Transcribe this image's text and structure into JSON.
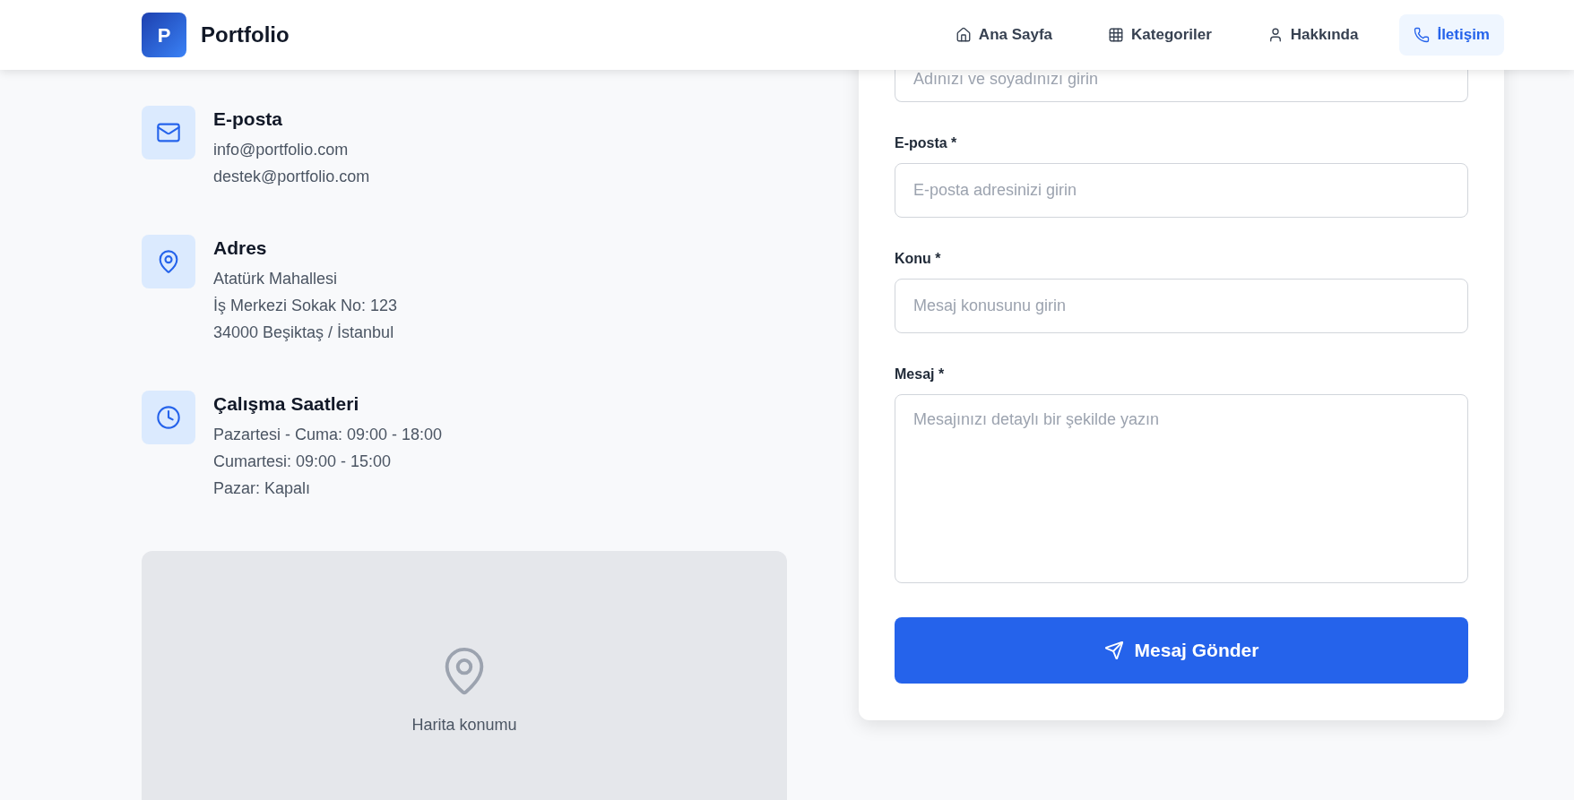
{
  "header": {
    "logo_letter": "P",
    "brand": "Portfolio",
    "nav": [
      {
        "label": "Ana Sayfa",
        "selected": false
      },
      {
        "label": "Kategoriler",
        "selected": false
      },
      {
        "label": "Hakkında",
        "selected": false
      },
      {
        "label": "İletişim",
        "selected": true
      }
    ]
  },
  "contact_info": [
    {
      "title": "E-posta",
      "lines": [
        "info@portfolio.com",
        "destek@portfolio.com"
      ]
    },
    {
      "title": "Adres",
      "lines": [
        "Atatürk Mahallesi",
        "İş Merkezi Sokak No: 123",
        "34000 Beşiktaş / İstanbul"
      ]
    },
    {
      "title": "Çalışma Saatleri",
      "lines": [
        "Pazartesi - Cuma: 09:00 - 18:00",
        "Cumartesi: 09:00 - 15:00",
        "Pazar: Kapalı"
      ]
    }
  ],
  "map": {
    "caption": "Harita konumu"
  },
  "form": {
    "fields": [
      {
        "kind": "cut_input",
        "placeholder": "Adınızı ve soyadınızı girin"
      },
      {
        "kind": "input",
        "label": "E-posta *",
        "placeholder": "E-posta adresinizi girin"
      },
      {
        "kind": "input",
        "label": "Konu *",
        "placeholder": "Mesaj konusunu girin"
      },
      {
        "kind": "textarea",
        "label": "Mesaj *",
        "placeholder": "Mesajınızı detaylı bir şekilde yazın"
      }
    ],
    "submit": "Mesaj Gönder"
  }
}
